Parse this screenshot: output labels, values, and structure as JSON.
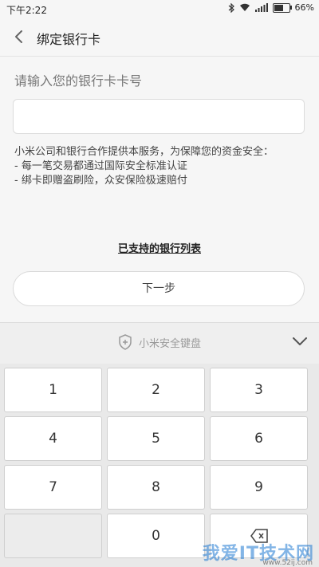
{
  "status_bar": {
    "time": "下午2:22",
    "battery_text": "66%",
    "battery_level": 0.66,
    "icons": [
      "bluetooth-icon",
      "wifi-icon",
      "signal-icon",
      "battery-icon"
    ]
  },
  "nav": {
    "back_icon": "chevron-left-icon",
    "title": "绑定银行卡"
  },
  "form": {
    "label": "请输入您的银行卡卡号",
    "card_input_value": "",
    "info_lines": [
      "小米公司和银行合作提供本服务，为保障您的资金安全：",
      "- 每一笔交易都通过国际安全标准认证",
      "- 绑卡即赠盗刷险，众安保险极速赔付"
    ],
    "supported_link": "已支持的银行列表",
    "next_button": "下一步"
  },
  "keyboard": {
    "title": "小米安全键盘",
    "shield_icon": "shield-icon",
    "collapse_icon": "chevron-down-icon",
    "keys": [
      "1",
      "2",
      "3",
      "4",
      "5",
      "6",
      "7",
      "8",
      "9",
      "",
      "0",
      "backspace"
    ]
  },
  "watermark": {
    "text": "我爱IT技术网",
    "sub": "www.52ij.com"
  },
  "colors": {
    "background": "#f6f6f6",
    "keyboard_bg": "#e9e9e9",
    "key_bg": "#ffffff"
  }
}
